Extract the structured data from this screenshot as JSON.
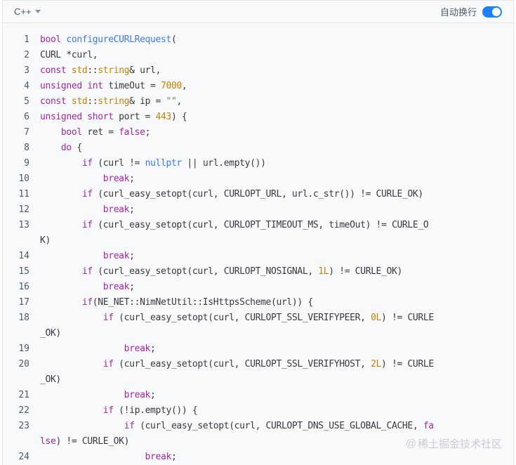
{
  "toolbar": {
    "language": "C++",
    "wrap_label": "自动换行",
    "wrap_enabled": true,
    "accent_color": "#1e80ff"
  },
  "code_lines": [
    {
      "n": "1",
      "tokens": [
        {
          "t": "bool ",
          "c": "kw"
        },
        {
          "t": "configureCURLRequest",
          "c": "fn"
        },
        {
          "t": "(",
          "c": "plain"
        }
      ]
    },
    {
      "n": "2",
      "tokens": [
        {
          "t": "CURL *curl,",
          "c": "plain"
        }
      ]
    },
    {
      "n": "3",
      "tokens": [
        {
          "t": "const ",
          "c": "kw"
        },
        {
          "t": "std",
          "c": "num"
        },
        {
          "t": "::",
          "c": "plain"
        },
        {
          "t": "string",
          "c": "num"
        },
        {
          "t": "& url,",
          "c": "plain"
        }
      ]
    },
    {
      "n": "4",
      "tokens": [
        {
          "t": "unsigned int ",
          "c": "kw"
        },
        {
          "t": "timeOut = ",
          "c": "plain"
        },
        {
          "t": "7000",
          "c": "num"
        },
        {
          "t": ",",
          "c": "plain"
        }
      ]
    },
    {
      "n": "5",
      "tokens": [
        {
          "t": "const ",
          "c": "kw"
        },
        {
          "t": "std",
          "c": "num"
        },
        {
          "t": "::",
          "c": "plain"
        },
        {
          "t": "string",
          "c": "num"
        },
        {
          "t": "& ip = ",
          "c": "plain"
        },
        {
          "t": "\"\"",
          "c": "str"
        },
        {
          "t": ",",
          "c": "plain"
        }
      ]
    },
    {
      "n": "6",
      "tokens": [
        {
          "t": "unsigned short ",
          "c": "kw"
        },
        {
          "t": "port = ",
          "c": "plain"
        },
        {
          "t": "443",
          "c": "num"
        },
        {
          "t": ") {",
          "c": "plain"
        }
      ]
    },
    {
      "n": "7",
      "tokens": [
        {
          "t": "    ",
          "c": "plain"
        },
        {
          "t": "bool ",
          "c": "kw"
        },
        {
          "t": "ret = ",
          "c": "plain"
        },
        {
          "t": "false",
          "c": "kw"
        },
        {
          "t": ";",
          "c": "plain"
        }
      ]
    },
    {
      "n": "8",
      "tokens": [
        {
          "t": "    ",
          "c": "plain"
        },
        {
          "t": "do",
          "c": "kw"
        },
        {
          "t": " {",
          "c": "plain"
        }
      ]
    },
    {
      "n": "9",
      "tokens": [
        {
          "t": "        ",
          "c": "plain"
        },
        {
          "t": "if",
          "c": "kw"
        },
        {
          "t": " (curl != ",
          "c": "plain"
        },
        {
          "t": "nullptr",
          "c": "fn"
        },
        {
          "t": " || url.empty())",
          "c": "plain"
        }
      ]
    },
    {
      "n": "10",
      "tokens": [
        {
          "t": "            ",
          "c": "plain"
        },
        {
          "t": "break",
          "c": "kw"
        },
        {
          "t": ";",
          "c": "plain"
        }
      ]
    },
    {
      "n": "11",
      "tokens": [
        {
          "t": "        ",
          "c": "plain"
        },
        {
          "t": "if",
          "c": "kw"
        },
        {
          "t": " (curl_easy_setopt(curl, CURLOPT_URL, url.c_str()) != CURLE_OK)",
          "c": "plain"
        }
      ]
    },
    {
      "n": "12",
      "tokens": [
        {
          "t": "            ",
          "c": "plain"
        },
        {
          "t": "break",
          "c": "kw"
        },
        {
          "t": ";",
          "c": "plain"
        }
      ]
    },
    {
      "n": "13",
      "tokens": [
        {
          "t": "        ",
          "c": "plain"
        },
        {
          "t": "if",
          "c": "kw"
        },
        {
          "t": " (curl_easy_setopt(curl, CURLOPT_TIMEOUT_MS, timeOut) != CURLE_O",
          "c": "plain"
        }
      ]
    },
    {
      "n": "",
      "cont": true,
      "tokens": [
        {
          "t": "K)",
          "c": "plain"
        }
      ]
    },
    {
      "n": "14",
      "tokens": [
        {
          "t": "            ",
          "c": "plain"
        },
        {
          "t": "break",
          "c": "kw"
        },
        {
          "t": ";",
          "c": "plain"
        }
      ]
    },
    {
      "n": "15",
      "tokens": [
        {
          "t": "        ",
          "c": "plain"
        },
        {
          "t": "if",
          "c": "kw"
        },
        {
          "t": " (curl_easy_setopt(curl, CURLOPT_NOSIGNAL, ",
          "c": "plain"
        },
        {
          "t": "1L",
          "c": "num"
        },
        {
          "t": ") != CURLE_OK)",
          "c": "plain"
        }
      ]
    },
    {
      "n": "16",
      "tokens": [
        {
          "t": "            ",
          "c": "plain"
        },
        {
          "t": "break",
          "c": "kw"
        },
        {
          "t": ";",
          "c": "plain"
        }
      ]
    },
    {
      "n": "17",
      "tokens": [
        {
          "t": "        ",
          "c": "plain"
        },
        {
          "t": "if",
          "c": "kw"
        },
        {
          "t": "(NE_NET::NimNetUtil::IsHttpsScheme(url)) {",
          "c": "plain"
        }
      ]
    },
    {
      "n": "18",
      "tokens": [
        {
          "t": "            ",
          "c": "plain"
        },
        {
          "t": "if",
          "c": "kw"
        },
        {
          "t": " (curl_easy_setopt(curl, CURLOPT_SSL_VERIFYPEER, ",
          "c": "plain"
        },
        {
          "t": "0L",
          "c": "num"
        },
        {
          "t": ") != CURLE",
          "c": "plain"
        }
      ]
    },
    {
      "n": "",
      "cont": true,
      "tokens": [
        {
          "t": "_OK)",
          "c": "plain"
        }
      ]
    },
    {
      "n": "19",
      "tokens": [
        {
          "t": "                ",
          "c": "plain"
        },
        {
          "t": "break",
          "c": "kw"
        },
        {
          "t": ";",
          "c": "plain"
        }
      ]
    },
    {
      "n": "20",
      "tokens": [
        {
          "t": "            ",
          "c": "plain"
        },
        {
          "t": "if",
          "c": "kw"
        },
        {
          "t": " (curl_easy_setopt(curl, CURLOPT_SSL_VERIFYHOST, ",
          "c": "plain"
        },
        {
          "t": "2L",
          "c": "num"
        },
        {
          "t": ") != CURLE",
          "c": "plain"
        }
      ]
    },
    {
      "n": "",
      "cont": true,
      "tokens": [
        {
          "t": "_OK)",
          "c": "plain"
        }
      ]
    },
    {
      "n": "21",
      "tokens": [
        {
          "t": "                ",
          "c": "plain"
        },
        {
          "t": "break",
          "c": "kw"
        },
        {
          "t": ";",
          "c": "plain"
        }
      ]
    },
    {
      "n": "22",
      "tokens": [
        {
          "t": "            ",
          "c": "plain"
        },
        {
          "t": "if",
          "c": "kw"
        },
        {
          "t": " (!ip.empty()) {",
          "c": "plain"
        }
      ]
    },
    {
      "n": "23",
      "tokens": [
        {
          "t": "                ",
          "c": "plain"
        },
        {
          "t": "if",
          "c": "kw"
        },
        {
          "t": " (curl_easy_setopt(curl, CURLOPT_DNS_USE_GLOBAL_CACHE, ",
          "c": "plain"
        },
        {
          "t": "fa",
          "c": "kw"
        }
      ]
    },
    {
      "n": "",
      "cont": true,
      "tokens": [
        {
          "t": "lse",
          "c": "kw"
        },
        {
          "t": ") != CURLE_OK)",
          "c": "plain"
        }
      ]
    },
    {
      "n": "24",
      "tokens": [
        {
          "t": "                    ",
          "c": "plain"
        },
        {
          "t": "break",
          "c": "kw"
        },
        {
          "t": ";",
          "c": "plain"
        }
      ]
    }
  ],
  "brand": {
    "at": "@",
    "text": "稀土掘金技术社区"
  }
}
